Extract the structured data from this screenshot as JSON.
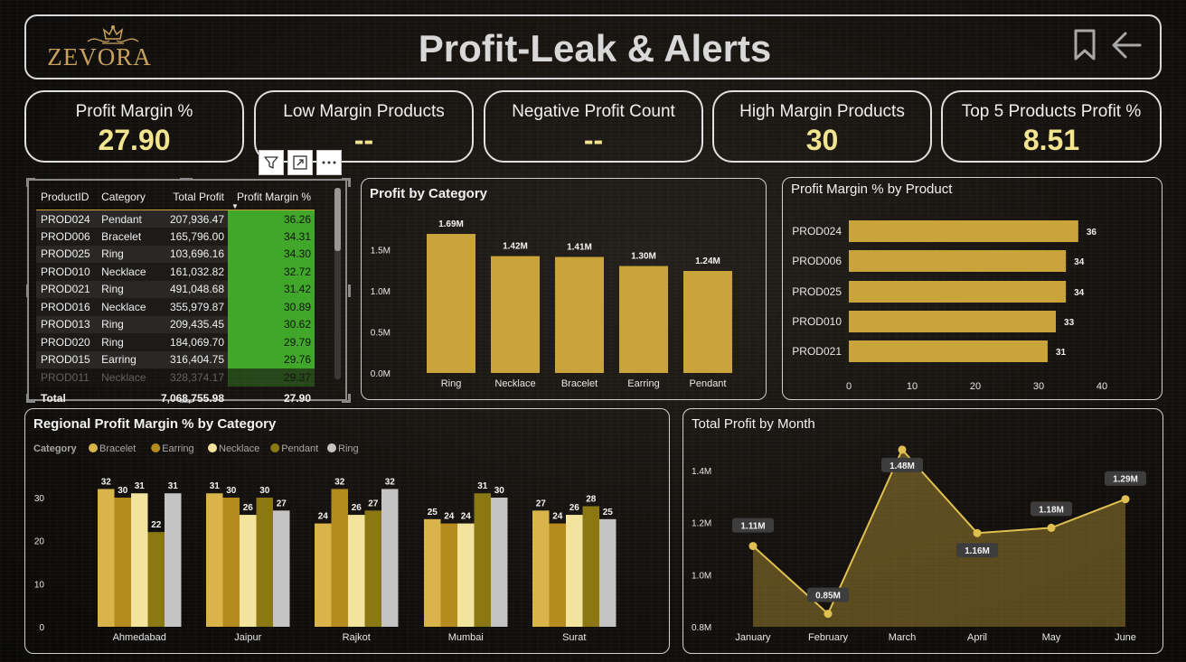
{
  "header": {
    "logo": "ZEVORA",
    "title": "Profit-Leak & Alerts"
  },
  "kpis": [
    {
      "label": "Profit Margin %",
      "value": "27.90"
    },
    {
      "label": "Low Margin Products",
      "value": "--"
    },
    {
      "label": "Negative Profit Count",
      "value": "--"
    },
    {
      "label": "High Margin Products",
      "value": "30"
    },
    {
      "label": "Top 5 Products Profit %",
      "value": "8.51"
    }
  ],
  "table": {
    "columns": [
      "ProductID",
      "Category",
      "Total Profit",
      "Profit Margin %"
    ],
    "rows": [
      [
        "PROD024",
        "Pendant",
        "207,936.47",
        "36.26"
      ],
      [
        "PROD006",
        "Bracelet",
        "165,796.00",
        "34.31"
      ],
      [
        "PROD025",
        "Ring",
        "103,696.16",
        "34.30"
      ],
      [
        "PROD010",
        "Necklace",
        "161,032.82",
        "32.72"
      ],
      [
        "PROD021",
        "Ring",
        "491,048.68",
        "31.42"
      ],
      [
        "PROD016",
        "Necklace",
        "355,979.87",
        "30.89"
      ],
      [
        "PROD013",
        "Ring",
        "209,435.45",
        "30.62"
      ],
      [
        "PROD020",
        "Ring",
        "184,069.70",
        "29.79"
      ],
      [
        "PROD015",
        "Earring",
        "316,404.75",
        "29.76"
      ],
      [
        "PROD011",
        "Necklace",
        "328,374.17",
        "29.37"
      ]
    ],
    "total": {
      "label": "Total",
      "profit": "7,068,755.98",
      "margin": "27.90"
    }
  },
  "colors": {
    "gold": "#c9a43a",
    "bracelet": "#d8b44a",
    "earring": "#b58a1e",
    "necklace": "#f2e49c",
    "pendant": "#8b7714",
    "ring": "#c4c4c4",
    "green": "#41a72a",
    "kpi_value": "#f3e48f"
  },
  "chart_data": [
    {
      "id": "profit-by-category",
      "type": "bar",
      "title": "Profit by Category",
      "categories": [
        "Ring",
        "Necklace",
        "Bracelet",
        "Earring",
        "Pendant"
      ],
      "values": [
        1.69,
        1.42,
        1.41,
        1.3,
        1.24
      ],
      "labels": [
        "1.69M",
        "1.42M",
        "1.41M",
        "1.30M",
        "1.24M"
      ],
      "yticks": [
        "0.0M",
        "0.5M",
        "1.0M",
        "1.5M"
      ],
      "ylim": [
        0,
        1.8
      ]
    },
    {
      "id": "profit-margin-by-product",
      "type": "bar",
      "orientation": "horizontal",
      "title": "Profit Margin % by Product",
      "categories": [
        "PROD024",
        "PROD006",
        "PROD025",
        "PROD010",
        "PROD021"
      ],
      "values": [
        36.26,
        34.31,
        34.3,
        32.72,
        31.42
      ],
      "labels": [
        "36",
        "34",
        "34",
        "33",
        "31"
      ],
      "xticks": [
        "0",
        "10",
        "20",
        "30",
        "40"
      ],
      "xlim": [
        0,
        40
      ]
    },
    {
      "id": "regional-profit-margin",
      "type": "bar",
      "title": "Regional Profit Margin % by Category",
      "legend_title": "Category",
      "categories": [
        "Ahmedabad",
        "Jaipur",
        "Rajkot",
        "Mumbai",
        "Surat"
      ],
      "series": [
        {
          "name": "Bracelet",
          "values": [
            32,
            31,
            24,
            25,
            27
          ]
        },
        {
          "name": "Earring",
          "values": [
            30,
            30,
            32,
            24,
            24
          ]
        },
        {
          "name": "Necklace",
          "values": [
            31,
            26,
            26,
            24,
            26
          ]
        },
        {
          "name": "Pendant",
          "values": [
            22,
            30,
            27,
            31,
            28
          ]
        },
        {
          "name": "Ring",
          "values": [
            31,
            27,
            32,
            30,
            25
          ]
        }
      ],
      "yticks": [
        "0",
        "10",
        "20",
        "30"
      ],
      "ylim": [
        0,
        35
      ]
    },
    {
      "id": "total-profit-by-month",
      "type": "area",
      "title": "Total Profit by Month",
      "x": [
        "January",
        "February",
        "March",
        "April",
        "May",
        "June"
      ],
      "values": [
        1.11,
        0.85,
        1.48,
        1.16,
        1.18,
        1.29
      ],
      "labels": [
        "1.11M",
        "0.85M",
        "1.48M",
        "1.16M",
        "1.18M",
        "1.29M"
      ],
      "yticks": [
        "0.8M",
        "1.0M",
        "1.2M",
        "1.4M"
      ],
      "ylim": [
        0.8,
        1.4
      ]
    }
  ]
}
